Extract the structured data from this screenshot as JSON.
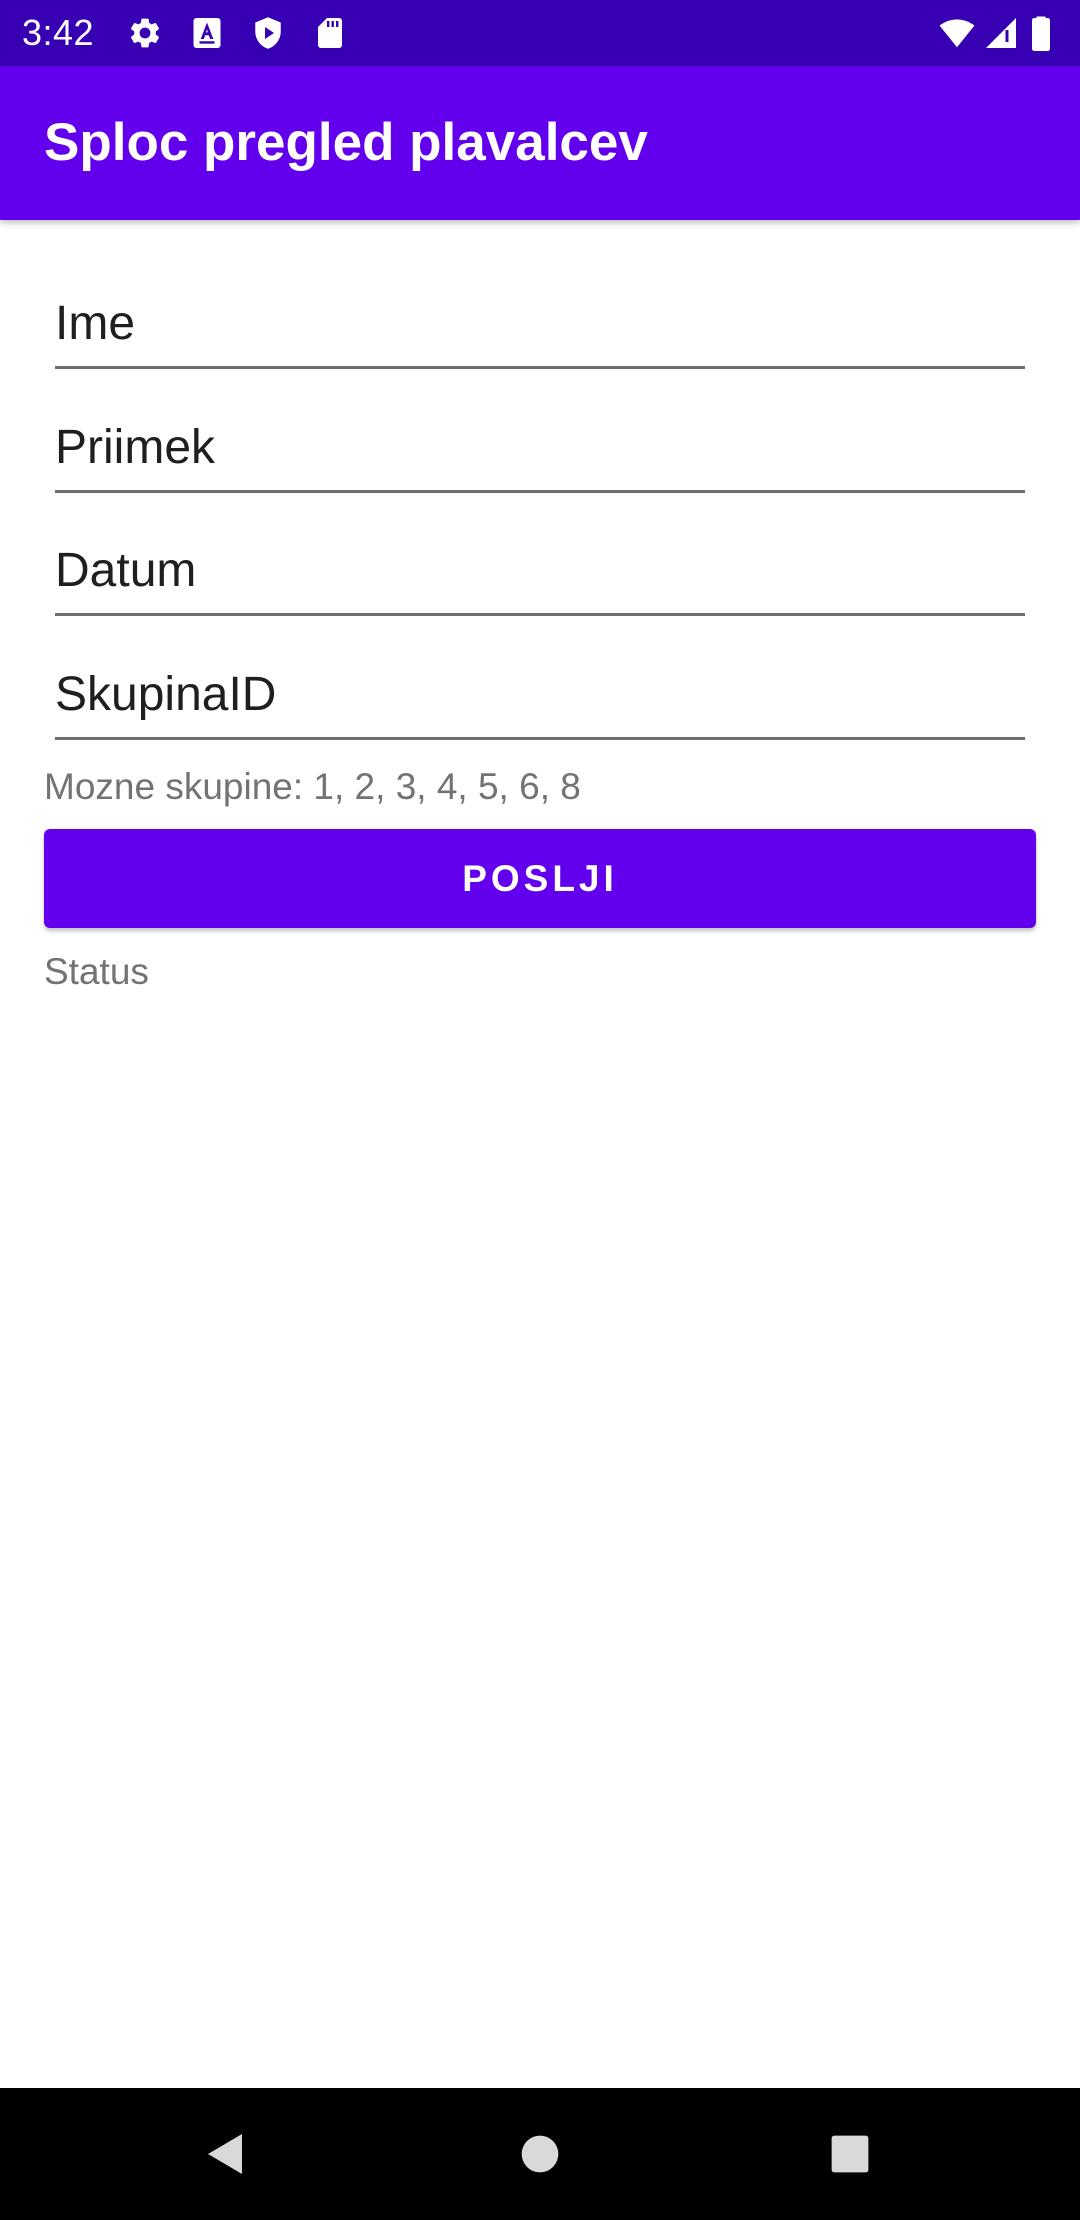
{
  "status_bar": {
    "time": "3:42",
    "left_icons": [
      "gear-icon",
      "font-a-icon",
      "shield-play-icon",
      "sd-card-icon"
    ],
    "right_icons": [
      "wifi-icon",
      "cellular-signal-icon",
      "battery-icon"
    ]
  },
  "app_bar": {
    "title": "Sploc pregled plavalcev"
  },
  "form": {
    "fields": [
      {
        "placeholder": "Ime",
        "value": ""
      },
      {
        "placeholder": "Priimek",
        "value": ""
      },
      {
        "placeholder": "Datum",
        "value": ""
      },
      {
        "placeholder": "SkupinaID",
        "value": ""
      }
    ],
    "hint": "Mozne skupine: 1, 2, 3, 4, 5, 6, 8",
    "submit_label": "POSLJI",
    "status": "Status"
  },
  "nav_bar": {
    "buttons": [
      "back-icon",
      "home-icon",
      "recents-icon"
    ]
  },
  "colors": {
    "status_bar": "#3700b3",
    "primary": "#6200ee",
    "secondary_text": "#737373",
    "nav_bar": "#000000"
  }
}
